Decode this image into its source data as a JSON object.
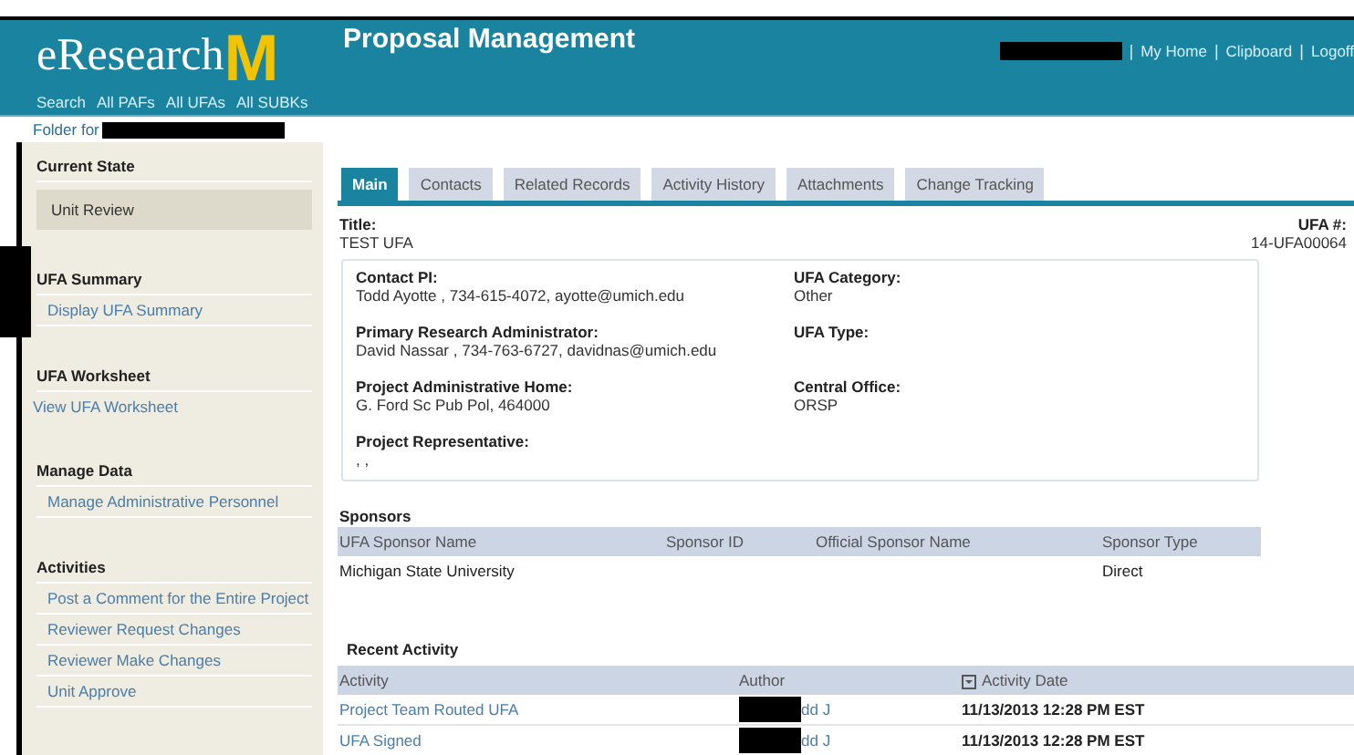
{
  "header": {
    "logo_text": "eResearch",
    "logo_mark": "M",
    "app_title": "Proposal Management",
    "nav": [
      "Search",
      "All PAFs",
      "All UFAs",
      "All SUBKs"
    ],
    "separator": "|",
    "user_links": [
      "My Home",
      "Clipboard",
      "Logoff"
    ],
    "folder_label": "Folder for"
  },
  "sidebar": [
    {
      "heading": "Current State",
      "items": [
        {
          "label": "Unit Review",
          "kind": "state"
        }
      ]
    },
    {
      "heading": "UFA Summary",
      "items": [
        {
          "label": "Display UFA Summary",
          "kind": "link"
        }
      ]
    },
    {
      "heading": "UFA Worksheet",
      "items": [
        {
          "label": "View UFA Worksheet",
          "kind": "flush-link"
        }
      ]
    },
    {
      "heading": "Manage Data",
      "items": [
        {
          "label": "Manage Administrative Personnel",
          "kind": "link"
        }
      ]
    },
    {
      "heading": "Activities",
      "items": [
        {
          "label": "Post a Comment for the Entire Project",
          "kind": "link"
        },
        {
          "label": "Reviewer Request Changes",
          "kind": "link"
        },
        {
          "label": "Reviewer Make Changes",
          "kind": "link"
        },
        {
          "label": "Unit Approve",
          "kind": "link"
        }
      ]
    }
  ],
  "tabs": [
    {
      "label": "Main",
      "selected": true
    },
    {
      "label": "Contacts",
      "selected": false
    },
    {
      "label": "Related Records",
      "selected": false
    },
    {
      "label": "Activity History",
      "selected": false
    },
    {
      "label": "Attachments",
      "selected": false
    },
    {
      "label": "Change Tracking",
      "selected": false
    }
  ],
  "title": {
    "label": "Title:",
    "value": "TEST UFA"
  },
  "ufa_number": {
    "label": "UFA #:",
    "value": "14-UFA00064"
  },
  "details": [
    [
      {
        "label": "Contact PI:",
        "value": "Todd Ayotte ,  734-615-4072,  ayotte@umich.edu"
      },
      {
        "label": "UFA Category:",
        "value": "Other"
      }
    ],
    [
      {
        "label": "Primary Research Administrator:",
        "value": "David Nassar ,  734-763-6727,  davidnas@umich.edu"
      },
      {
        "label": "UFA Type:"
      }
    ],
    [
      {
        "label": "Project Administrative Home:",
        "value": "G. Ford Sc Pub Pol,  464000"
      },
      {
        "label": "Central Office:",
        "value": "ORSP"
      }
    ],
    [
      {
        "label": "Project Representative:",
        "value": ", ,"
      }
    ]
  ],
  "sponsors": {
    "heading": "Sponsors",
    "columns": [
      "UFA Sponsor Name",
      "Sponsor ID",
      "Official Sponsor Name",
      "Sponsor Type"
    ],
    "rows": [
      [
        "Michigan State University",
        "",
        "",
        "Direct"
      ]
    ]
  },
  "recent_activity": {
    "heading": "Recent Activity",
    "columns": [
      "Activity",
      "Author",
      "Activity Date"
    ],
    "rows": [
      {
        "activity": "Project Team Routed UFA",
        "author": "dd J",
        "date": "11/13/2013 12:28 PM EST"
      },
      {
        "activity": "UFA Signed",
        "author": "dd J",
        "date": "11/13/2013 12:28 PM EST"
      }
    ]
  }
}
